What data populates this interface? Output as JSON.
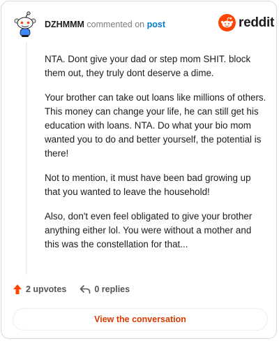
{
  "comment": {
    "author": "DZHMMM",
    "action_text": "commented on",
    "post_link_label": "post",
    "paragraphs": [
      "NTA. Dont give your dad or step mom SHIT. block them out, they truly dont deserve a dime.",
      "Your brother can take out loans like millions of others. This money can change your life, he can still get his education with loans. NTA. Do what your bio mom wanted you to do and better yourself, the potential is there!",
      "Not to mention, it must have been bad growing up that you wanted to leave the household!",
      "Also, don't even feel obligated to give your brother anything either lol. You were without a mother and this was the constellation for that..."
    ]
  },
  "brand": {
    "wordmark": "reddit",
    "logo_icon": "reddit-snoo-icon",
    "color": "#ff4500"
  },
  "actions": {
    "upvotes_label": "2 upvotes",
    "replies_label": "0 replies",
    "upvote_icon": "upvote-arrow-icon",
    "reply_icon": "reply-arrow-icon"
  },
  "cta": {
    "label": "View the conversation",
    "color": "#d93a00"
  },
  "colors": {
    "link": "#0079d3",
    "border": "#d7dadc",
    "upvote": "#ff4500"
  }
}
